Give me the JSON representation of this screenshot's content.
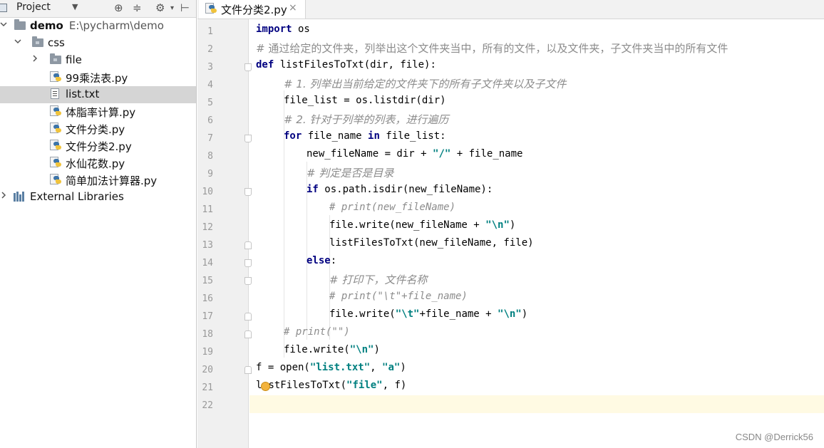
{
  "sidebar": {
    "header": {
      "title": "Project"
    },
    "tree": [
      {
        "label": "demo",
        "path": "E:\\pycharm\\demo"
      },
      {
        "label": "css"
      },
      {
        "label": "file"
      },
      {
        "label": "99乘法表.py"
      },
      {
        "label": "list.txt"
      },
      {
        "label": "体脂率计算.py"
      },
      {
        "label": "文件分类.py"
      },
      {
        "label": "文件分类2.py"
      },
      {
        "label": "水仙花数.py"
      },
      {
        "label": "简单加法计算器.py"
      },
      {
        "label": "External Libraries"
      }
    ]
  },
  "editor": {
    "tab": {
      "label": "文件分类2.py",
      "close": "×"
    },
    "line_numbers": [
      "1",
      "2",
      "3",
      "4",
      "5",
      "6",
      "7",
      "8",
      "9",
      "10",
      "11",
      "12",
      "13",
      "14",
      "15",
      "16",
      "17",
      "18",
      "19",
      "20",
      "21",
      "22"
    ],
    "current_line": 22,
    "code": {
      "l1": {
        "k": "import",
        "t": " os"
      },
      "l2": "# 通过给定的文件夹，列举出这个文件夹当中，所有的文件，以及文件夹，子文件夹当中的所有文件",
      "l3": {
        "k": "def",
        "t": " listFilesToTxt(dir, file):"
      },
      "l4": "# 1. 列举出当前给定的文件夹下的所有子文件夹以及子文件",
      "l5": "file_list = os.listdir(dir)",
      "l6": "# 2. 针对于列举的列表，进行遍历",
      "l7": {
        "k1": "for",
        "t1": " file_name ",
        "k2": "in",
        "t2": " file_list:"
      },
      "l8": {
        "t1": "new_fileName = dir + ",
        "s1": "\"/\"",
        "t2": " + file_name"
      },
      "l9": "# 判定是否是目录",
      "l10": {
        "k": "if",
        "t": " os.path.isdir(new_fileName):"
      },
      "l11": "# print(new_fileName)",
      "l12": {
        "t1": "file.write(new_fileName + ",
        "s1": "\"\\n\"",
        "t2": ")"
      },
      "l13": "listFilesToTxt(new_fileName, file)",
      "l14": {
        "k": "else",
        "t": ":"
      },
      "l15": "# 打印下，文件名称",
      "l16": "# print(\"\\t\"+file_name)",
      "l17": {
        "t1": "file.write(",
        "s1": "\"\\t\"",
        "t2": "+file_name + ",
        "s2": "\"\\n\"",
        "t3": ")"
      },
      "l18": "# print(\"\")",
      "l19": {
        "t1": "file.write(",
        "s1": "\"\\n\"",
        "t2": ")"
      },
      "l20": {
        "t1": "f = open(",
        "s1": "\"list.txt\"",
        "t2": ", ",
        "s2": "\"a\"",
        "t3": ")"
      },
      "l21": {
        "t0": "l",
        "t1": "stFilesToTxt(",
        "s1": "\"file\"",
        "t2": ", f)"
      }
    }
  },
  "watermark": "CSDN @Derrick56",
  "colors": {
    "keyword": "#000080",
    "string": "#008080",
    "comment": "#8c8c8c",
    "selection": "#d5d5d5",
    "current_line": "#fffae3"
  }
}
